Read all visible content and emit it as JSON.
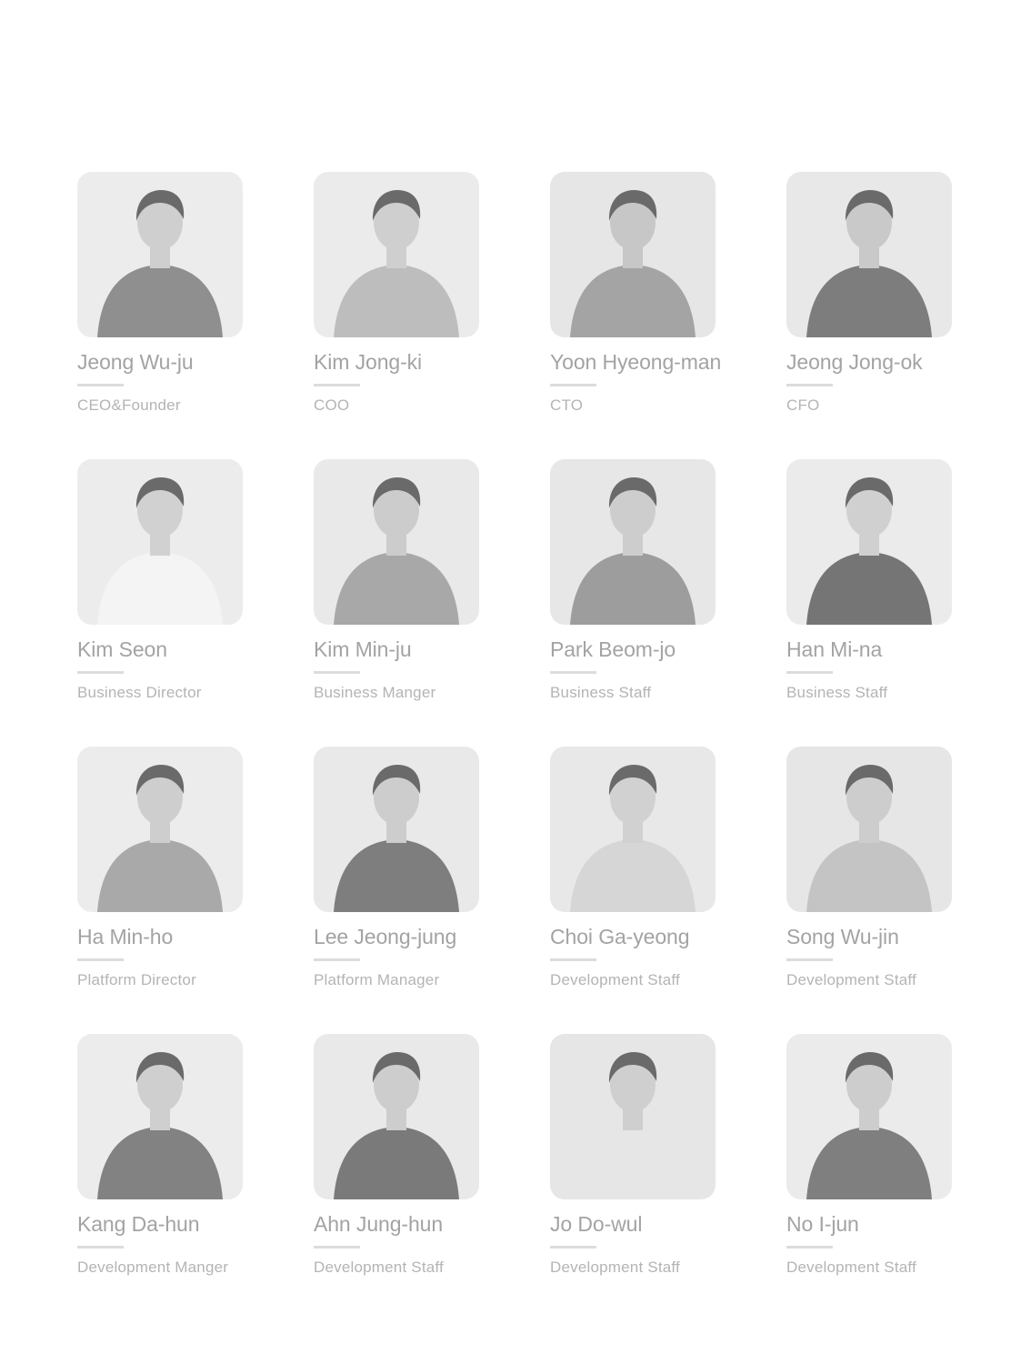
{
  "team": {
    "members": [
      {
        "name": "Jeong Wu-ju",
        "role": "CEO&Founder",
        "photo_alt": "portrait",
        "tone": "#cfcfcf",
        "shirt": "#8f8f8f",
        "bg": "#ececec"
      },
      {
        "name": "Kim Jong-ki",
        "role": "COO",
        "photo_alt": "portrait",
        "tone": "#cfcfcf",
        "shirt": "#bdbdbd",
        "bg": "#ebebeb"
      },
      {
        "name": "Yoon Hyeong-man",
        "role": "CTO",
        "photo_alt": "portrait",
        "tone": "#c7c7c7",
        "shirt": "#a4a4a4",
        "bg": "#e6e6e6"
      },
      {
        "name": "Jeong Jong-ok",
        "role": "CFO",
        "photo_alt": "portrait",
        "tone": "#c9c9c9",
        "shirt": "#7d7d7d",
        "bg": "#e8e8e8"
      },
      {
        "name": "Kim Seon",
        "role": "Business Director",
        "photo_alt": "portrait",
        "tone": "#d1d1d1",
        "shirt": "#f4f4f4",
        "bg": "#ececec"
      },
      {
        "name": "Kim Min-ju",
        "role": "Business Manger",
        "photo_alt": "portrait",
        "tone": "#cccccc",
        "shirt": "#a8a8a8",
        "bg": "#e9e9e9"
      },
      {
        "name": "Park Beom-jo",
        "role": "Business Staff",
        "photo_alt": "portrait",
        "tone": "#cdcdcd",
        "shirt": "#9d9d9d",
        "bg": "#e7e7e7"
      },
      {
        "name": "Han Mi-na",
        "role": "Business Staff",
        "photo_alt": "portrait",
        "tone": "#d0d0d0",
        "shirt": "#757575",
        "bg": "#ebebeb"
      },
      {
        "name": "Ha Min-ho",
        "role": "Platform Director",
        "photo_alt": "portrait",
        "tone": "#cecece",
        "shirt": "#a9a9a9",
        "bg": "#ececec"
      },
      {
        "name": "Lee Jeong-jung",
        "role": "Platform Manager",
        "photo_alt": "portrait",
        "tone": "#cdcdcd",
        "shirt": "#7e7e7e",
        "bg": "#e9e9e9"
      },
      {
        "name": "Choi Ga-yeong",
        "role": "Development Staff",
        "photo_alt": "portrait",
        "tone": "#d1d1d1",
        "shirt": "#d6d6d6",
        "bg": "#e8e8e8"
      },
      {
        "name": "Song Wu-jin",
        "role": "Development Staff",
        "photo_alt": "portrait",
        "tone": "#cdcdcd",
        "shirt": "#c4c4c4",
        "bg": "#e6e6e6"
      },
      {
        "name": "Kang Da-hun",
        "role": "Development Manger",
        "photo_alt": "portrait",
        "tone": "#cfcfcf",
        "shirt": "#828282",
        "bg": "#ececec"
      },
      {
        "name": "Ahn Jung-hun",
        "role": "Development Staff",
        "photo_alt": "portrait",
        "tone": "#cdcdcd",
        "shirt": "#7a7a7a",
        "bg": "#e9e9e9"
      },
      {
        "name": "Jo Do-wul",
        "role": "Development Staff",
        "photo_alt": "portrait",
        "tone": "#cfcfcf",
        "shirt": "#e6e6e6",
        "bg": "#e6e6e6"
      },
      {
        "name": "No I-jun",
        "role": "Development Staff",
        "photo_alt": "portrait",
        "tone": "#cdcdcd",
        "shirt": "#7f7f7f",
        "bg": "#ebebeb"
      }
    ]
  }
}
